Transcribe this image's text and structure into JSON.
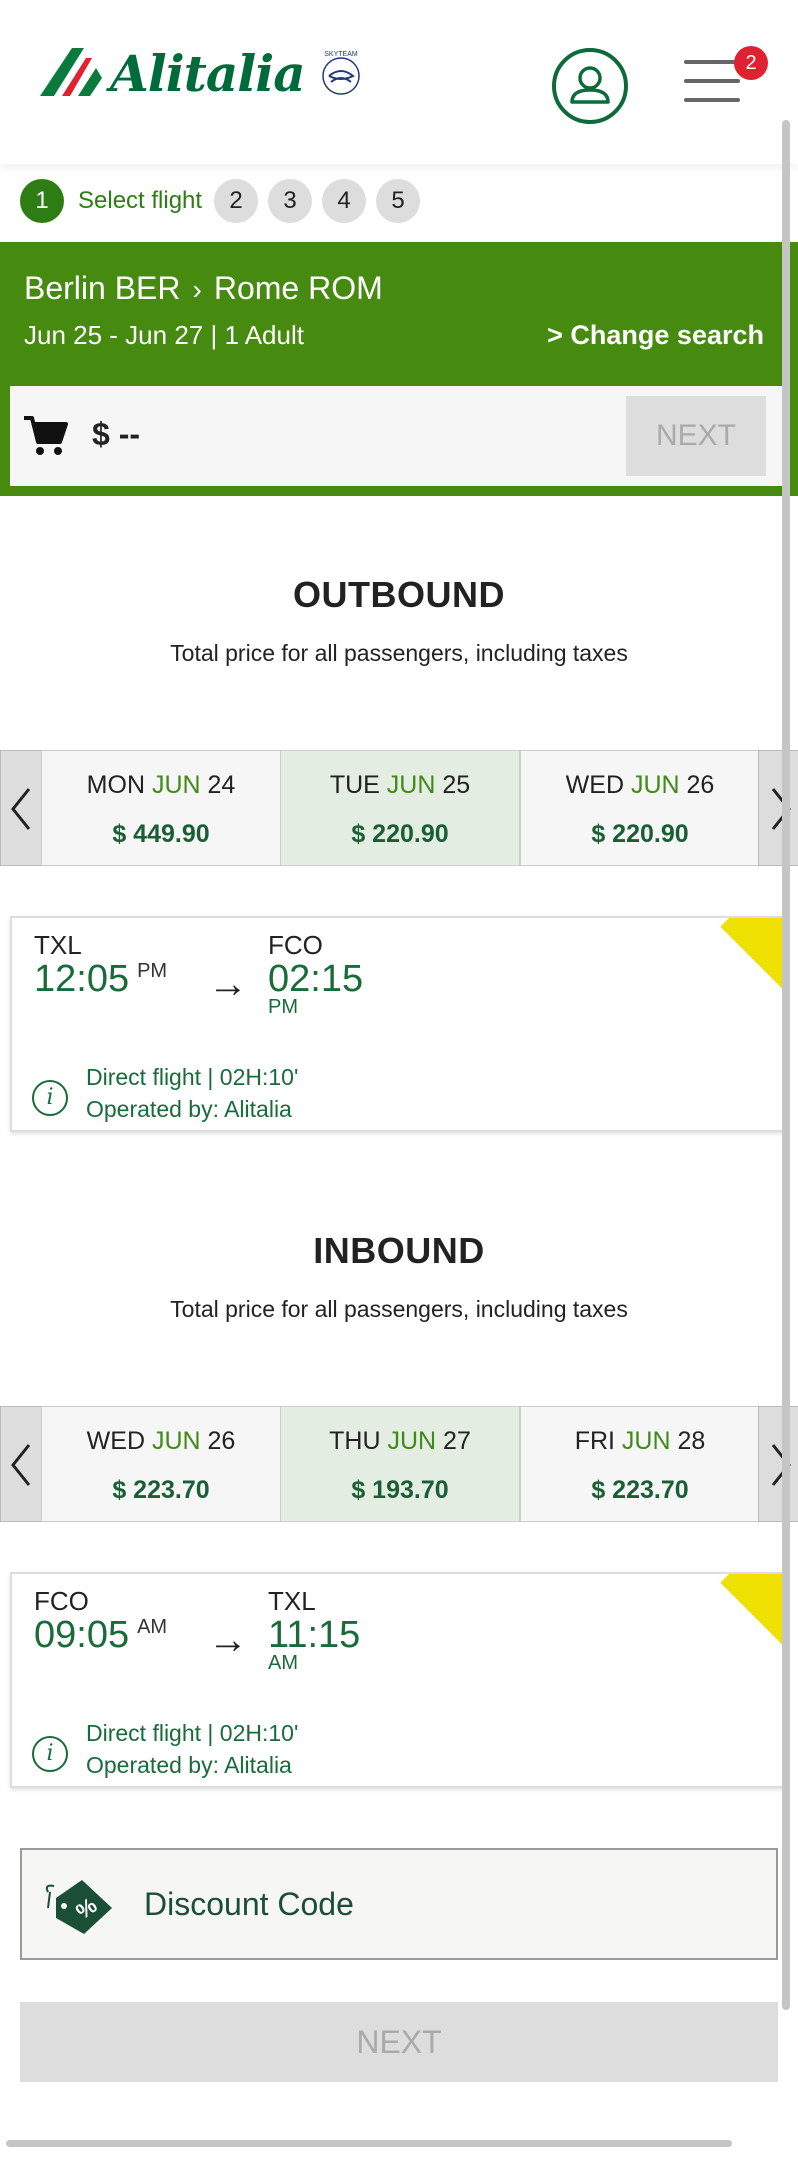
{
  "header": {
    "logo_text": "Alitalia",
    "skyteam": "SKYTEAM",
    "notification_count": "2"
  },
  "steps": {
    "active_number": "1",
    "active_label": "Select flight",
    "others": [
      "2",
      "3",
      "4",
      "5"
    ]
  },
  "summary": {
    "origin": "Berlin BER",
    "destination": "Rome ROM",
    "dates_prefix1": "Jun ",
    "date1": "25",
    "dates_mid": " - Jun ",
    "date2": "27",
    "pax": " | 1 Adult",
    "change_search": "Change search",
    "price": "$ --",
    "next_label": "NEXT"
  },
  "outbound": {
    "title": "OUTBOUND",
    "subtitle": "Total price for all passengers, including taxes",
    "days": [
      {
        "dow": "MON",
        "month": "JUN",
        "day": "24",
        "price": "$ 449.90",
        "selected": false
      },
      {
        "dow": "TUE",
        "month": "JUN",
        "day": "25",
        "price": "$ 220.90",
        "selected": true
      },
      {
        "dow": "WED",
        "month": "JUN",
        "day": "26",
        "price": "$ 220.90",
        "selected": false
      }
    ],
    "flight": {
      "dep_code": "TXL",
      "dep_time": "12:05",
      "dep_ampm": "PM",
      "arr_code": "FCO",
      "arr_time": "02:15",
      "arr_ampm": "PM",
      "info": "Direct flight | 02H:10'",
      "operator": "Operated by: Alitalia"
    }
  },
  "inbound": {
    "title": "INBOUND",
    "subtitle": "Total price for all passengers, including taxes",
    "days": [
      {
        "dow": "WED",
        "month": "JUN",
        "day": "26",
        "price": "$ 223.70",
        "selected": false
      },
      {
        "dow": "THU",
        "month": "JUN",
        "day": "27",
        "price": "$ 193.70",
        "selected": true
      },
      {
        "dow": "FRI",
        "month": "JUN",
        "day": "28",
        "price": "$ 223.70",
        "selected": false
      }
    ],
    "flight": {
      "dep_code": "FCO",
      "dep_time": "09:05",
      "dep_ampm": "AM",
      "arr_code": "TXL",
      "arr_time": "11:15",
      "arr_ampm": "AM",
      "info": "Direct flight | 02H:10'",
      "operator": "Operated by: Alitalia"
    }
  },
  "discount": {
    "label": "Discount Code"
  },
  "footer": {
    "next_label": "NEXT"
  },
  "colors": {
    "brand_green": "#468a10",
    "dark_green": "#1a6b3a",
    "badge_red": "#e0212f",
    "ribbon_yellow": "#eee000"
  }
}
